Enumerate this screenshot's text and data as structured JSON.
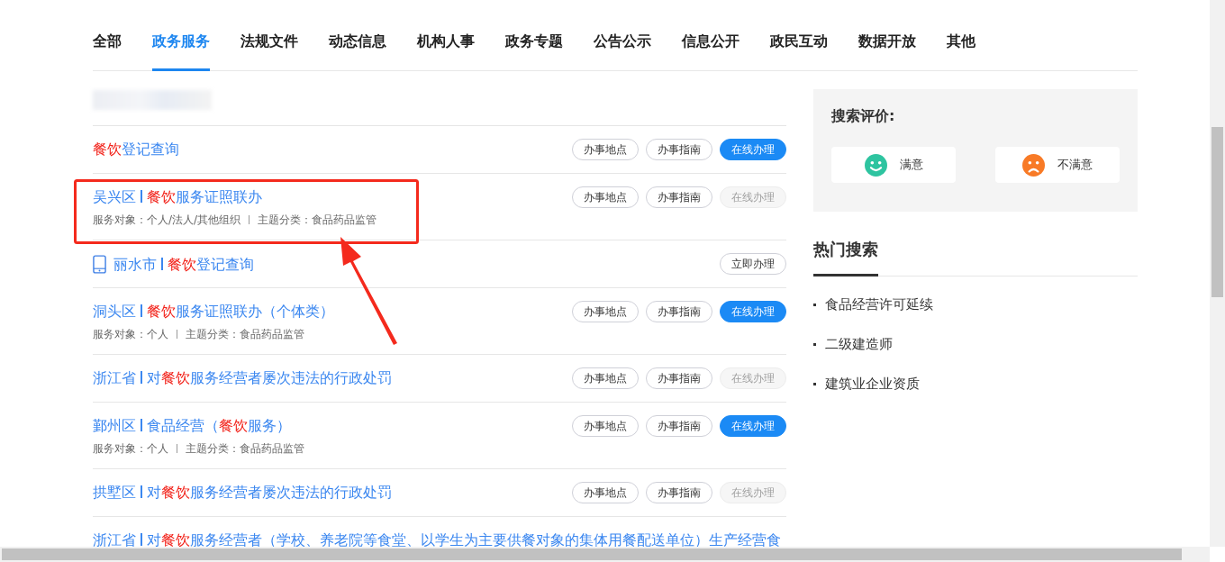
{
  "tabs": [
    {
      "label": "全部",
      "selected": false
    },
    {
      "label": "政务服务",
      "selected": true
    },
    {
      "label": "法规文件",
      "selected": false
    },
    {
      "label": "动态信息",
      "selected": false
    },
    {
      "label": "机构人事",
      "selected": false
    },
    {
      "label": "政务专题",
      "selected": false
    },
    {
      "label": "公告公示",
      "selected": false
    },
    {
      "label": "信息公开",
      "selected": false
    },
    {
      "label": "政民互动",
      "selected": false
    },
    {
      "label": "数据开放",
      "selected": false
    },
    {
      "label": "其他",
      "selected": false
    }
  ],
  "results": [
    {
      "mobile": false,
      "parts": [
        {
          "text": "餐饮",
          "highlight": true
        },
        {
          "text": "登记查询",
          "highlight": false
        }
      ],
      "buttons": [
        {
          "label": "办事地点",
          "kind": "outline",
          "disabled": false
        },
        {
          "label": "办事指南",
          "kind": "outline",
          "disabled": false
        },
        {
          "label": "在线办理",
          "kind": "primary",
          "disabled": false
        }
      ]
    },
    {
      "mobile": false,
      "region": "吴兴区",
      "parts": [
        {
          "text": "餐饮",
          "highlight": true
        },
        {
          "text": "服务证照联办",
          "highlight": false
        }
      ],
      "meta": [
        "服务对象：个人/法人/其他组织",
        "主题分类：食品药品监管"
      ],
      "buttons": [
        {
          "label": "办事地点",
          "kind": "outline",
          "disabled": false
        },
        {
          "label": "办事指南",
          "kind": "outline",
          "disabled": false
        },
        {
          "label": "在线办理",
          "kind": "primary",
          "disabled": true
        }
      ]
    },
    {
      "mobile": true,
      "region": "丽水市",
      "parts": [
        {
          "text": "餐饮",
          "highlight": true
        },
        {
          "text": "登记查询",
          "highlight": false
        }
      ],
      "buttons": [
        {
          "label": "立即办理",
          "kind": "outline",
          "disabled": false
        }
      ]
    },
    {
      "mobile": false,
      "region": "洞头区",
      "parts": [
        {
          "text": "餐饮",
          "highlight": true
        },
        {
          "text": "服务证照联办（个体类）",
          "highlight": false
        }
      ],
      "meta": [
        "服务对象：个人",
        "主题分类：食品药品监管"
      ],
      "buttons": [
        {
          "label": "办事地点",
          "kind": "outline",
          "disabled": false
        },
        {
          "label": "办事指南",
          "kind": "outline",
          "disabled": false
        },
        {
          "label": "在线办理",
          "kind": "primary",
          "disabled": false
        }
      ]
    },
    {
      "mobile": false,
      "region": "浙江省",
      "parts": [
        {
          "text": "对",
          "highlight": false
        },
        {
          "text": "餐饮",
          "highlight": true
        },
        {
          "text": "服务经营者屡次违法的行政处罚",
          "highlight": false
        }
      ],
      "buttons": [
        {
          "label": "办事地点",
          "kind": "outline",
          "disabled": false
        },
        {
          "label": "办事指南",
          "kind": "outline",
          "disabled": false
        },
        {
          "label": "在线办理",
          "kind": "primary",
          "disabled": true
        }
      ]
    },
    {
      "mobile": false,
      "region": "鄞州区",
      "parts": [
        {
          "text": "食品经营（",
          "highlight": false
        },
        {
          "text": "餐饮",
          "highlight": true
        },
        {
          "text": "服务）",
          "highlight": false
        }
      ],
      "meta": [
        "服务对象：个人",
        "主题分类：食品药品监管"
      ],
      "buttons": [
        {
          "label": "办事地点",
          "kind": "outline",
          "disabled": false
        },
        {
          "label": "办事指南",
          "kind": "outline",
          "disabled": false
        },
        {
          "label": "在线办理",
          "kind": "primary",
          "disabled": false
        }
      ]
    },
    {
      "mobile": false,
      "region": "拱墅区",
      "parts": [
        {
          "text": "对",
          "highlight": false
        },
        {
          "text": "餐饮",
          "highlight": true
        },
        {
          "text": "服务经营者屡次违法的行政处罚",
          "highlight": false
        }
      ],
      "buttons": [
        {
          "label": "办事地点",
          "kind": "outline",
          "disabled": false
        },
        {
          "label": "办事指南",
          "kind": "outline",
          "disabled": false
        },
        {
          "label": "在线办理",
          "kind": "primary",
          "disabled": true
        }
      ]
    },
    {
      "mobile": false,
      "region": "浙江省",
      "parts": [
        {
          "text": "对",
          "highlight": false
        },
        {
          "text": "餐饮",
          "highlight": true
        },
        {
          "text": "服务经营者（学校、养老院等食堂、以学生为主要供餐对象的集体用餐配送单位）生产经营食",
          "highlight": false
        }
      ]
    }
  ],
  "rating": {
    "title": "搜索评价:",
    "options": [
      {
        "label": "满意",
        "kind": "happy"
      },
      {
        "label": "不满意",
        "kind": "sad"
      }
    ]
  },
  "hot_search": {
    "title": "热门搜索",
    "items": [
      "食品经营许可延续",
      "二级建造师",
      "建筑业企业资质"
    ]
  }
}
